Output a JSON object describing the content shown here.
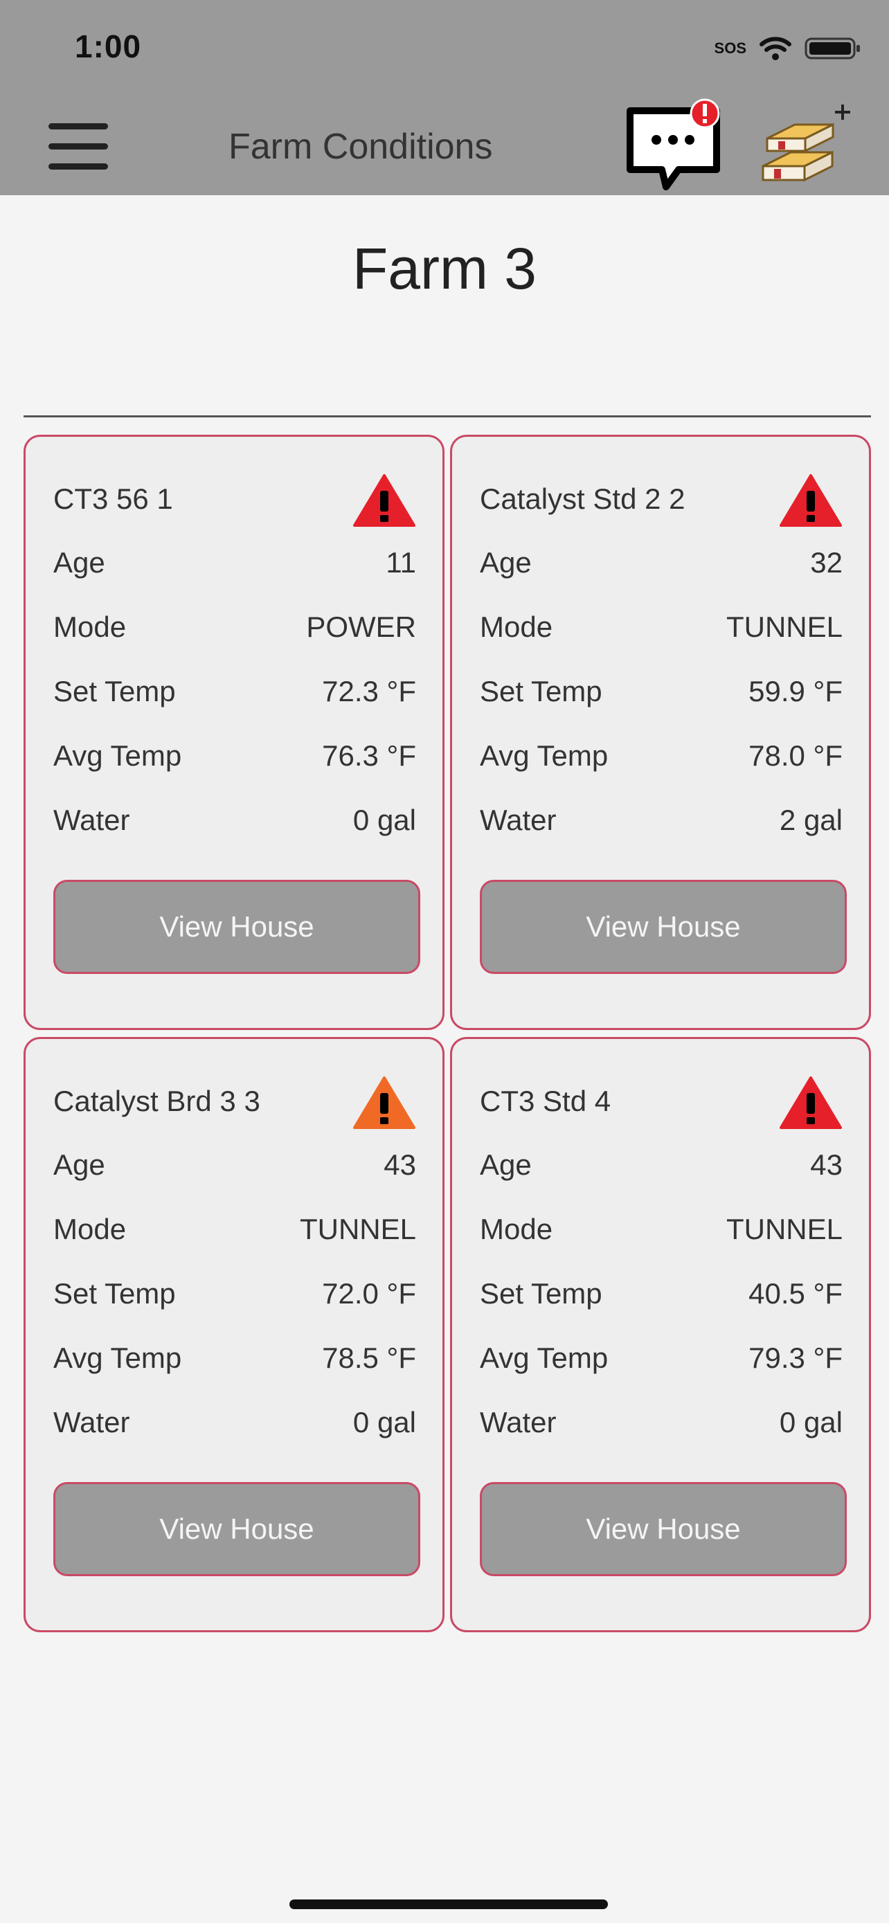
{
  "status_bar": {
    "time": "1:00",
    "sos": "SOS"
  },
  "header": {
    "title": "Farm Conditions"
  },
  "page": {
    "title": "Farm 3"
  },
  "colors": {
    "header_bg": "#9a9a9a",
    "card_border": "#c94a66",
    "alert_red": "#e5202a",
    "alert_orange": "#f06a25",
    "button_bg": "#9b9b9b"
  },
  "cards": [
    {
      "name": "CT3 56 1",
      "alert": "red",
      "rows": [
        {
          "label": "Age",
          "value": "11"
        },
        {
          "label": "Mode",
          "value": "POWER"
        },
        {
          "label": "Set Temp",
          "value": "72.3 °F"
        },
        {
          "label": "Avg Temp",
          "value": "76.3 °F"
        },
        {
          "label": "Water",
          "value": "0 gal"
        }
      ],
      "button": "View House"
    },
    {
      "name": "Catalyst Std 2 2",
      "alert": "red",
      "rows": [
        {
          "label": "Age",
          "value": "32"
        },
        {
          "label": "Mode",
          "value": "TUNNEL"
        },
        {
          "label": "Set Temp",
          "value": "59.9 °F"
        },
        {
          "label": "Avg Temp",
          "value": "78.0 °F"
        },
        {
          "label": "Water",
          "value": "2 gal"
        }
      ],
      "button": "View House"
    },
    {
      "name": "Catalyst Brd 3 3",
      "alert": "orange",
      "rows": [
        {
          "label": "Age",
          "value": "43"
        },
        {
          "label": "Mode",
          "value": "TUNNEL"
        },
        {
          "label": "Set Temp",
          "value": "72.0 °F"
        },
        {
          "label": "Avg Temp",
          "value": "78.5 °F"
        },
        {
          "label": "Water",
          "value": "0 gal"
        }
      ],
      "button": "View House"
    },
    {
      "name": "CT3 Std 4",
      "alert": "red",
      "rows": [
        {
          "label": "Age",
          "value": "43"
        },
        {
          "label": "Mode",
          "value": "TUNNEL"
        },
        {
          "label": "Set Temp",
          "value": "40.5 °F"
        },
        {
          "label": "Avg Temp",
          "value": "79.3 °F"
        },
        {
          "label": "Water",
          "value": "0 gal"
        }
      ],
      "button": "View House"
    }
  ]
}
